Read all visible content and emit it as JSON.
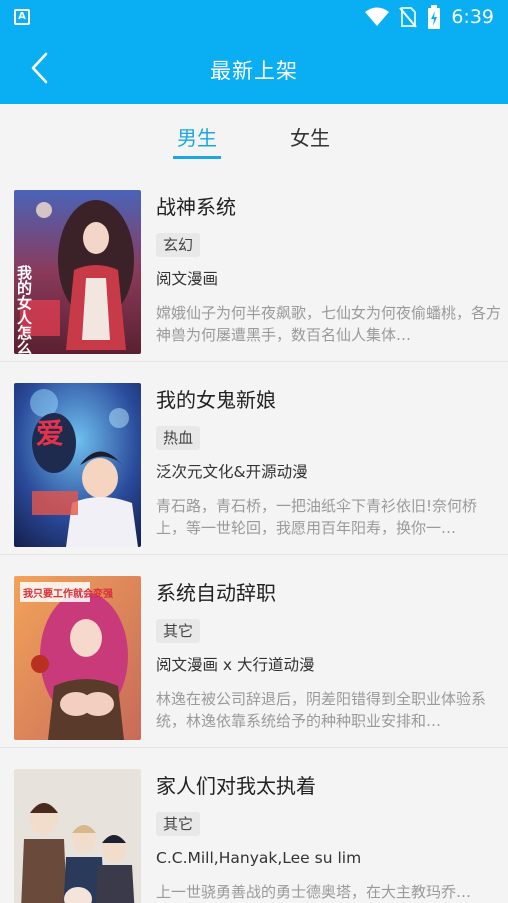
{
  "status": {
    "time": "6:39",
    "app_icon_letter": "A"
  },
  "header": {
    "title": "最新上架",
    "back_icon": "chevron-left-icon"
  },
  "tabs": [
    {
      "label": "男生",
      "active": true
    },
    {
      "label": "女生",
      "active": false
    }
  ],
  "colors": {
    "accent": "#0aaef3",
    "tab_active": "#1ba7e4"
  },
  "comics": [
    {
      "title": "战神系统",
      "tag": "玄幻",
      "author": "阅文漫画",
      "desc": "嫦娥仙子为何半夜飙歌，七仙女为何夜偷蟠桃，各方神兽为何屡遭黑手，数百名仙人集体…",
      "cover_text": "我的女人怎么可能是仙"
    },
    {
      "title": "我的女鬼新娘",
      "tag": "热血",
      "author": "泛次元文化&开源动漫",
      "desc": "青石路，青石桥，一把油纸伞下青衫依旧!奈何桥上，等一世轮回，我愿用百年阳寿，换你一…",
      "cover_text": "爱"
    },
    {
      "title": "系统自动辞职",
      "tag": "其它",
      "author": "阅文漫画 x 大行道动漫",
      "desc": "林逸在被公司辞退后，阴差阳错得到全职业体验系统，林逸依靠系统给予的种种职业安排和…",
      "cover_text": "我只要工作就会变强"
    },
    {
      "title": "家人们对我太执着",
      "tag": "其它",
      "author": "C.C.Mill,Hanyak,Lee su lim",
      "desc": "上一世骁勇善战的勇士德奥塔，在大主教玛乔…",
      "cover_text": ""
    }
  ]
}
